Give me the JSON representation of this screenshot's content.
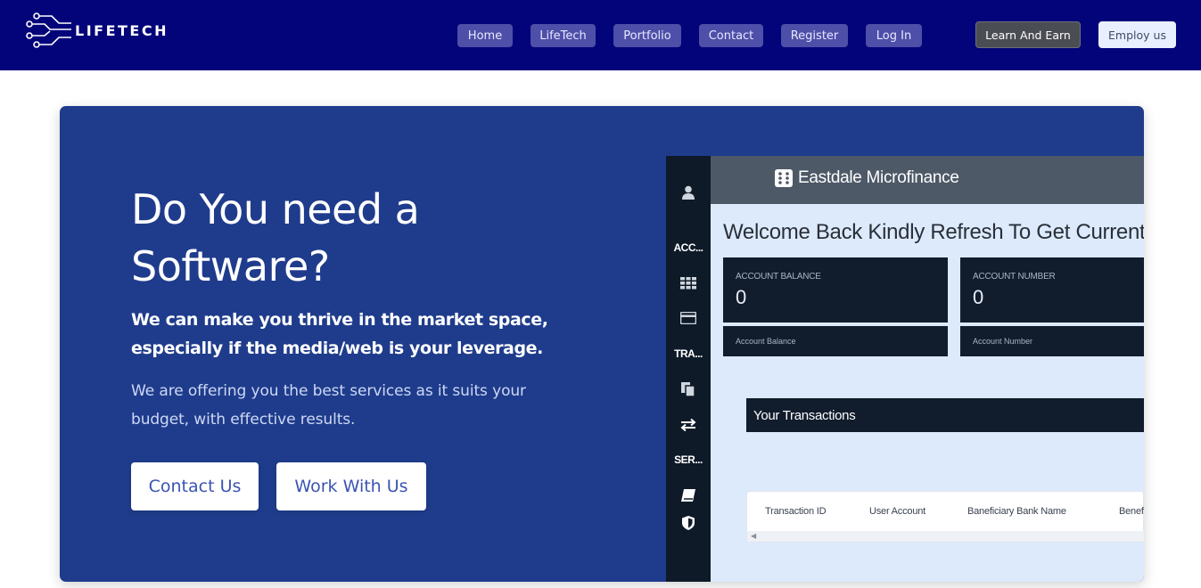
{
  "brand": {
    "name": "LIFETECH"
  },
  "nav": {
    "items": [
      "Home",
      "LifeTech",
      "Portfolio",
      "Contact",
      "Register",
      "Log In"
    ],
    "learn_label": "Learn And Earn",
    "employ_label": "Employ us"
  },
  "hero": {
    "title": "Do You need a Software?",
    "subtitle": "We can make you thrive in the market space, especially if the media/web is your leverage.",
    "description": "We are offering you the best services as it suits your budget, with effective results.",
    "contact_label": "Contact Us",
    "work_label": "Work With Us"
  },
  "mockup": {
    "brand": "Eastdale Microfinance",
    "welcome": "Welcome Back Kindly Refresh To Get Current Data",
    "sidebar": [
      "ACC...",
      "TRA...",
      "SER..."
    ],
    "cards": [
      {
        "label": "ACCOUNT BALANCE",
        "value": "0",
        "footer": "Account Balance"
      },
      {
        "label": "ACCOUNT NUMBER",
        "value": "0",
        "footer": "Account Number"
      }
    ],
    "transactions_title": "Your Transactions",
    "table_headers": [
      "Transaction ID",
      "User Account",
      "Baneficiary Bank Name",
      "Benefi"
    ]
  }
}
